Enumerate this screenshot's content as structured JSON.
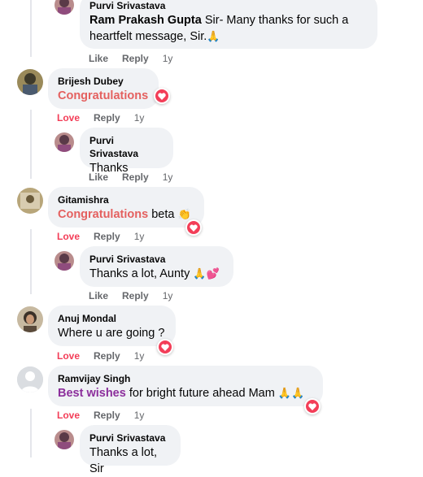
{
  "comments": [
    {
      "id": "c0",
      "author": "Purvi Srivastava",
      "mention": "Ram Prakash Gupta",
      "text": " Sir- Many thanks for such a heartfelt message, Sir.",
      "emoji": "🙏",
      "actions": {
        "like": "Like",
        "reply": "Reply",
        "time": "1y"
      }
    },
    {
      "id": "c1",
      "author": "Brijesh Dubey",
      "highlight": "Congratulations",
      "text": "",
      "reaction": "heart",
      "actions": {
        "like": "Love",
        "reply": "Reply",
        "time": "1y"
      }
    },
    {
      "id": "c2",
      "author": "Purvi Srivastava",
      "text": "Thanks",
      "actions": {
        "like": "Like",
        "reply": "Reply",
        "time": "1y"
      }
    },
    {
      "id": "c3",
      "author": "Gitamishra",
      "highlight": "Congratulations",
      "text": " beta ",
      "emoji": "👏",
      "reaction": "heart",
      "actions": {
        "like": "Love",
        "reply": "Reply",
        "time": "1y"
      }
    },
    {
      "id": "c4",
      "author": "Purvi Srivastava",
      "text": "Thanks a lot, Aunty ",
      "emoji": "🙏💕",
      "actions": {
        "like": "Like",
        "reply": "Reply",
        "time": "1y"
      }
    },
    {
      "id": "c5",
      "author": "Anuj Mondal",
      "text": "Where u are going ?",
      "reaction": "heart",
      "actions": {
        "like": "Love",
        "reply": "Reply",
        "time": "1y"
      }
    },
    {
      "id": "c6",
      "author": "Ramvijay Singh",
      "highlight": "Best wishes",
      "text": " for bright future ahead Mam ",
      "emoji": "🙏🙏",
      "reaction": "heart",
      "actions": {
        "like": "Love",
        "reply": "Reply",
        "time": "1y"
      }
    },
    {
      "id": "c7",
      "author": "Purvi Srivastava",
      "text": "Thanks a lot, Sir"
    }
  ],
  "colors": {
    "bubble": "#f0f2f5",
    "love": "#f33e58",
    "congratulations": "#e4605f",
    "best_wishes": "#8c2f9c",
    "meta": "#65676b"
  },
  "icons": {
    "reaction": "heart-icon",
    "avatar_placeholder": "user-silhouette-icon"
  }
}
